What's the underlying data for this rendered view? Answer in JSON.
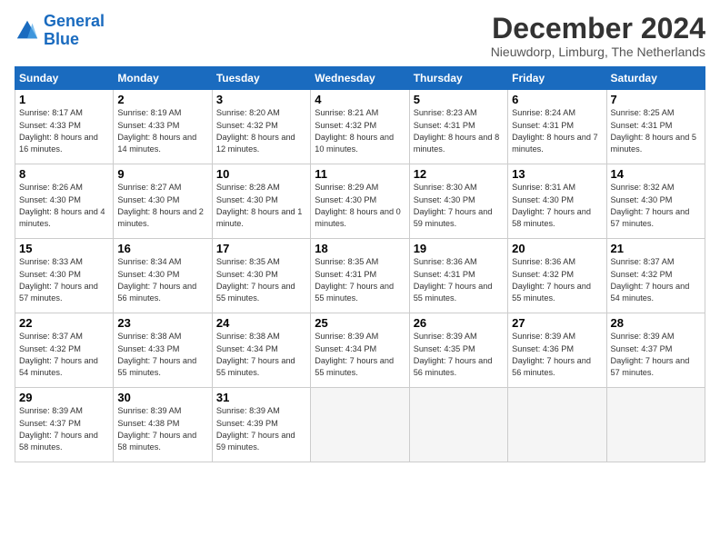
{
  "header": {
    "logo_line1": "General",
    "logo_line2": "Blue",
    "month_title": "December 2024",
    "subtitle": "Nieuwdorp, Limburg, The Netherlands"
  },
  "weekdays": [
    "Sunday",
    "Monday",
    "Tuesday",
    "Wednesday",
    "Thursday",
    "Friday",
    "Saturday"
  ],
  "weeks": [
    [
      {
        "day": 1,
        "sunrise": "8:17 AM",
        "sunset": "4:33 PM",
        "daylight": "8 hours and 16 minutes."
      },
      {
        "day": 2,
        "sunrise": "8:19 AM",
        "sunset": "4:33 PM",
        "daylight": "8 hours and 14 minutes."
      },
      {
        "day": 3,
        "sunrise": "8:20 AM",
        "sunset": "4:32 PM",
        "daylight": "8 hours and 12 minutes."
      },
      {
        "day": 4,
        "sunrise": "8:21 AM",
        "sunset": "4:32 PM",
        "daylight": "8 hours and 10 minutes."
      },
      {
        "day": 5,
        "sunrise": "8:23 AM",
        "sunset": "4:31 PM",
        "daylight": "8 hours and 8 minutes."
      },
      {
        "day": 6,
        "sunrise": "8:24 AM",
        "sunset": "4:31 PM",
        "daylight": "8 hours and 7 minutes."
      },
      {
        "day": 7,
        "sunrise": "8:25 AM",
        "sunset": "4:31 PM",
        "daylight": "8 hours and 5 minutes."
      }
    ],
    [
      {
        "day": 8,
        "sunrise": "8:26 AM",
        "sunset": "4:30 PM",
        "daylight": "8 hours and 4 minutes."
      },
      {
        "day": 9,
        "sunrise": "8:27 AM",
        "sunset": "4:30 PM",
        "daylight": "8 hours and 2 minutes."
      },
      {
        "day": 10,
        "sunrise": "8:28 AM",
        "sunset": "4:30 PM",
        "daylight": "8 hours and 1 minute."
      },
      {
        "day": 11,
        "sunrise": "8:29 AM",
        "sunset": "4:30 PM",
        "daylight": "8 hours and 0 minutes."
      },
      {
        "day": 12,
        "sunrise": "8:30 AM",
        "sunset": "4:30 PM",
        "daylight": "7 hours and 59 minutes."
      },
      {
        "day": 13,
        "sunrise": "8:31 AM",
        "sunset": "4:30 PM",
        "daylight": "7 hours and 58 minutes."
      },
      {
        "day": 14,
        "sunrise": "8:32 AM",
        "sunset": "4:30 PM",
        "daylight": "7 hours and 57 minutes."
      }
    ],
    [
      {
        "day": 15,
        "sunrise": "8:33 AM",
        "sunset": "4:30 PM",
        "daylight": "7 hours and 57 minutes."
      },
      {
        "day": 16,
        "sunrise": "8:34 AM",
        "sunset": "4:30 PM",
        "daylight": "7 hours and 56 minutes."
      },
      {
        "day": 17,
        "sunrise": "8:35 AM",
        "sunset": "4:30 PM",
        "daylight": "7 hours and 55 minutes."
      },
      {
        "day": 18,
        "sunrise": "8:35 AM",
        "sunset": "4:31 PM",
        "daylight": "7 hours and 55 minutes."
      },
      {
        "day": 19,
        "sunrise": "8:36 AM",
        "sunset": "4:31 PM",
        "daylight": "7 hours and 55 minutes."
      },
      {
        "day": 20,
        "sunrise": "8:36 AM",
        "sunset": "4:32 PM",
        "daylight": "7 hours and 55 minutes."
      },
      {
        "day": 21,
        "sunrise": "8:37 AM",
        "sunset": "4:32 PM",
        "daylight": "7 hours and 54 minutes."
      }
    ],
    [
      {
        "day": 22,
        "sunrise": "8:37 AM",
        "sunset": "4:32 PM",
        "daylight": "7 hours and 54 minutes."
      },
      {
        "day": 23,
        "sunrise": "8:38 AM",
        "sunset": "4:33 PM",
        "daylight": "7 hours and 55 minutes."
      },
      {
        "day": 24,
        "sunrise": "8:38 AM",
        "sunset": "4:34 PM",
        "daylight": "7 hours and 55 minutes."
      },
      {
        "day": 25,
        "sunrise": "8:39 AM",
        "sunset": "4:34 PM",
        "daylight": "7 hours and 55 minutes."
      },
      {
        "day": 26,
        "sunrise": "8:39 AM",
        "sunset": "4:35 PM",
        "daylight": "7 hours and 56 minutes."
      },
      {
        "day": 27,
        "sunrise": "8:39 AM",
        "sunset": "4:36 PM",
        "daylight": "7 hours and 56 minutes."
      },
      {
        "day": 28,
        "sunrise": "8:39 AM",
        "sunset": "4:37 PM",
        "daylight": "7 hours and 57 minutes."
      }
    ],
    [
      {
        "day": 29,
        "sunrise": "8:39 AM",
        "sunset": "4:37 PM",
        "daylight": "7 hours and 58 minutes."
      },
      {
        "day": 30,
        "sunrise": "8:39 AM",
        "sunset": "4:38 PM",
        "daylight": "7 hours and 58 minutes."
      },
      {
        "day": 31,
        "sunrise": "8:39 AM",
        "sunset": "4:39 PM",
        "daylight": "7 hours and 59 minutes."
      },
      null,
      null,
      null,
      null
    ]
  ]
}
